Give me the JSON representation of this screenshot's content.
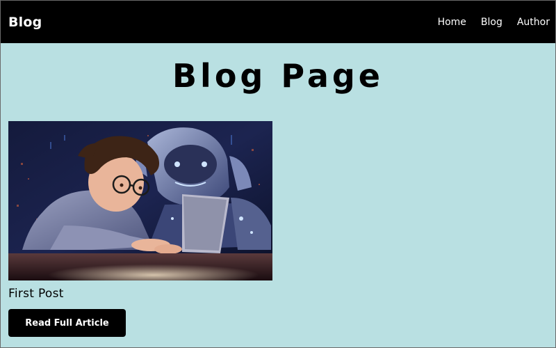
{
  "navbar": {
    "brand": "Blog",
    "links": [
      {
        "label": "Home"
      },
      {
        "label": "Blog"
      },
      {
        "label": "Author"
      }
    ]
  },
  "page": {
    "title": "Blog Page"
  },
  "posts": [
    {
      "title": "First Post",
      "button_label": "Read Full Article",
      "image_description_icon": "illustration-boy-laptop-robot"
    }
  ],
  "colors": {
    "navbar_bg": "#000000",
    "page_bg": "#b9e0e2",
    "button_bg": "#000000",
    "text": "#000000"
  }
}
